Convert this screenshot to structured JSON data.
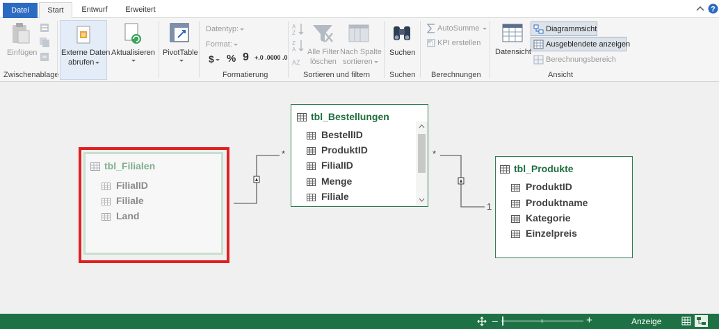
{
  "tabs": {
    "file": "Datei",
    "start": "Start",
    "design": "Entwurf",
    "advanced": "Erweitert"
  },
  "ribbon": {
    "clipboard": {
      "paste": "Einfügen",
      "group": "Zwischenablage"
    },
    "external": {
      "line1": "Externe Daten",
      "line2": "abrufen"
    },
    "refresh": {
      "label": "Aktualisieren"
    },
    "pivot": {
      "label": "PivotTable"
    },
    "formatting": {
      "datatype": "Datentyp:",
      "format": "Format:",
      "currency": "$",
      "percent": "%",
      "comma": "9",
      "inc": "+.0 .00",
      "dec": "-.00 .0",
      "group": "Formatierung"
    },
    "sort": {
      "clear_line1": "Alle Filter",
      "clear_line2": "löschen",
      "sortby_line1": "Nach Spalte",
      "sortby_line2": "sortieren",
      "group": "Sortieren und filtern"
    },
    "find": {
      "label": "Suchen",
      "group": "Suchen"
    },
    "calc": {
      "autosum": "AutoSumme",
      "kpi": "KPI erstellen",
      "group": "Berechnungen"
    },
    "view": {
      "dataview": "Datensicht",
      "diagram": "Diagrammsicht",
      "hidden": "Ausgeblendete anzeigen",
      "calcarea": "Berechnungsbereich",
      "group": "Ansicht"
    }
  },
  "tables": {
    "filialen": {
      "title": "tbl_Filialen",
      "fields": [
        "FilialID",
        "Filiale",
        "Land"
      ]
    },
    "bestellungen": {
      "title": "tbl_Bestellungen",
      "fields": [
        "BestellID",
        "ProduktID",
        "FilialID",
        "Menge",
        "Filiale"
      ]
    },
    "produkte": {
      "title": "tbl_Produkte",
      "fields": [
        "ProduktID",
        "Produktname",
        "Kategorie",
        "Einzelpreis"
      ]
    }
  },
  "relations": {
    "many1": "*",
    "many2": "*",
    "one2": "1"
  },
  "status": {
    "view_label": "Anzeige",
    "zoom_minus": "–",
    "zoom_plus": "+"
  },
  "colors": {
    "accent": "#1e7145",
    "file_tab": "#2b6bc2",
    "highlight": "#e02020"
  }
}
